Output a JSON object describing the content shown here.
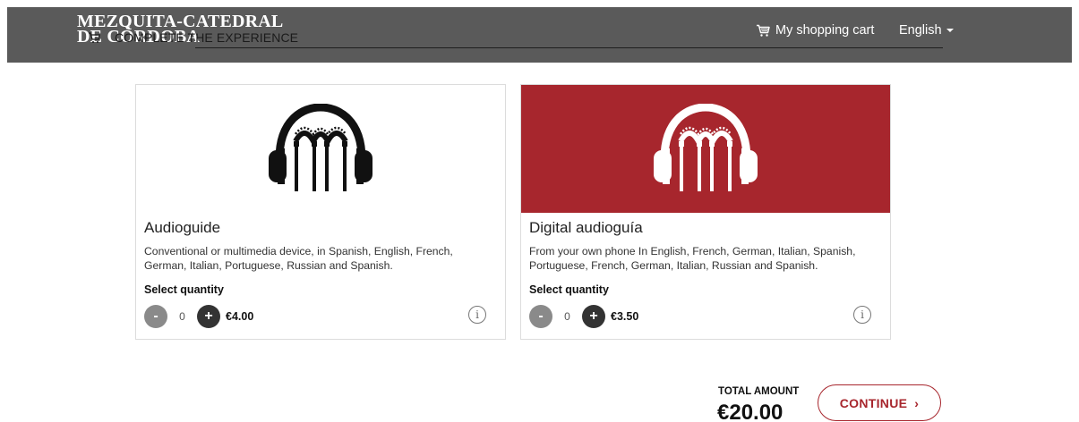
{
  "header": {
    "brand_line1": "MEZQUITA-CATEDRAL",
    "brand_line2": "DE CÓRDOBA",
    "ghost_text": "COMPLETE THE EXPERIENCE",
    "cart_label": "My shopping cart",
    "language_label": "English",
    "icons": {
      "cart": "shopping-cart-icon",
      "language": "chevron-down-icon"
    }
  },
  "products": [
    {
      "title": "Audioguide",
      "description": "Conventional or multimedia device, in Spanish, English, French, German, Italian, Portuguese, Russian and Spanish.",
      "quantity_label": "Select quantity",
      "quantity": "0",
      "price": "€4.00",
      "minus_label": "-",
      "plus_label": "+",
      "info_label": "i",
      "image_bg": "#ffffff",
      "icon": "headphones-arches-icon"
    },
    {
      "title": "Digital audioguía",
      "description": "From your own phone In English, French, German, Italian, Spanish, Portuguese, French, German, Italian, Russian and Spanish.",
      "quantity_label": "Select quantity",
      "quantity": "0",
      "price": "€3.50",
      "minus_label": "-",
      "plus_label": "+",
      "info_label": "i",
      "image_bg": "#a7262d",
      "icon": "headphones-arches-icon"
    }
  ],
  "summary": {
    "total_label": "TOTAL AMOUNT",
    "total_amount": "€20.00",
    "continue_label": "CONTINUE",
    "continue_arrow": "›"
  },
  "colors": {
    "header_bg": "#5a5a5a",
    "accent": "#a7262d",
    "minus_button": "#8a8a8a",
    "plus_button": "#333333"
  }
}
